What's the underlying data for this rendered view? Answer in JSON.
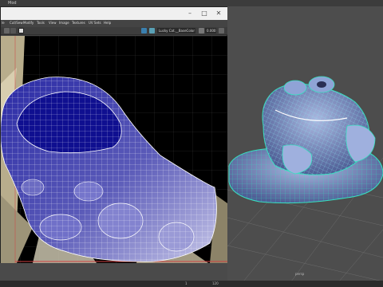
{
  "top_bar": {
    "left_text": "Mod",
    "right_text": "Sign in"
  },
  "uv_window": {
    "menus": [
      "le",
      "Cut/Sew",
      "Modify",
      "Tools",
      "View",
      "Image",
      "Textures",
      "UV Sets",
      "Help"
    ],
    "texture_field": "Lucky Cat.__BaseColor",
    "texture_field_suffix": "0.000"
  },
  "viewport": {
    "camera_label": "persp"
  },
  "bottom_bar": {
    "frame_start": "1",
    "frame_end": "120"
  },
  "colors": {
    "uv_shell_fill": "#2f2fa8",
    "uv_wire": "#ffffff",
    "viewport_bg": "#4d4d4d",
    "model_wire": "#36e0c0",
    "model_shading": "#7a8fbf"
  },
  "icons": [
    "close-icon",
    "minimize-icon",
    "maximize-icon",
    "grid-icon",
    "uv-shell-icon",
    "texture-icon",
    "checker-icon",
    "slider-icon"
  ]
}
